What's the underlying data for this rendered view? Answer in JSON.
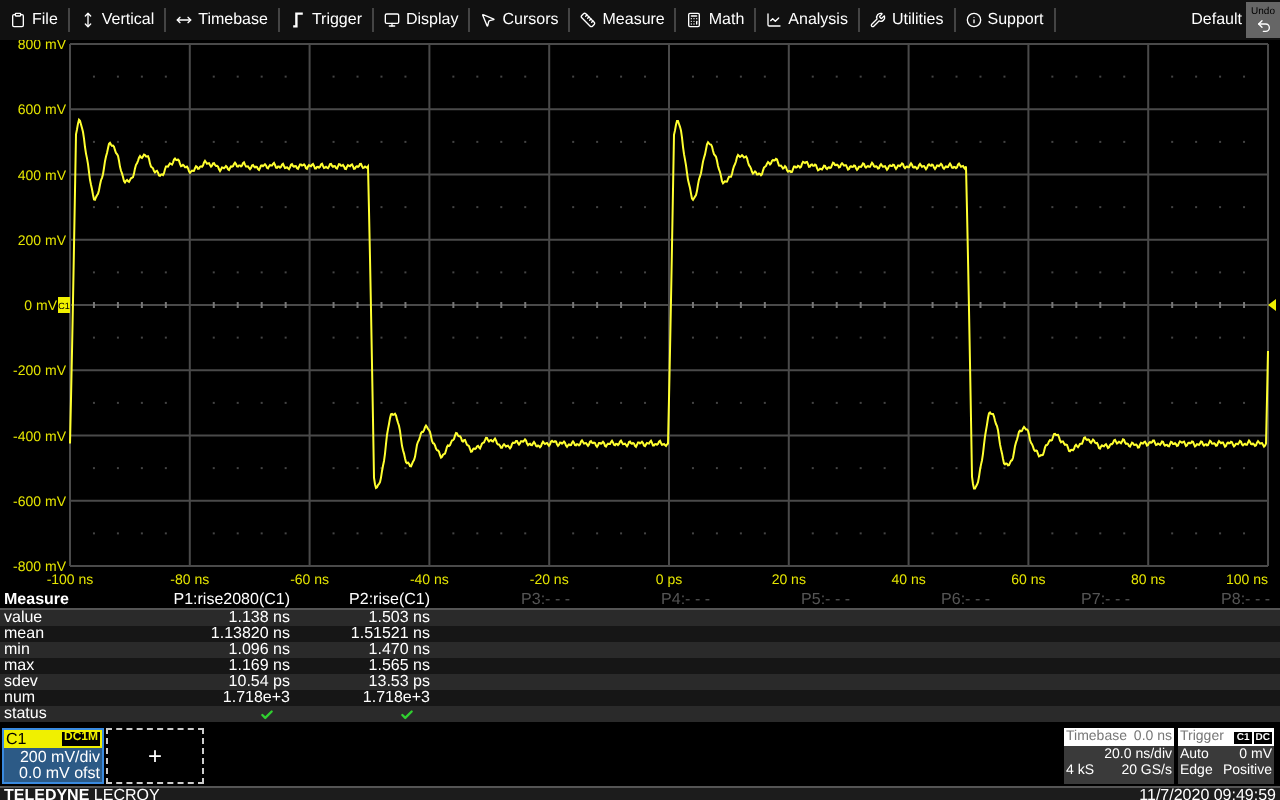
{
  "menu": [
    {
      "label": "File"
    },
    {
      "label": "Vertical"
    },
    {
      "label": "Timebase"
    },
    {
      "label": "Trigger"
    },
    {
      "label": "Display"
    },
    {
      "label": "Cursors"
    },
    {
      "label": "Measure"
    },
    {
      "label": "Math"
    },
    {
      "label": "Analysis"
    },
    {
      "label": "Utilities"
    },
    {
      "label": "Support"
    }
  ],
  "default_label": "Default",
  "undo_button": "Undo",
  "plot": {
    "y_labels": [
      "800 mV",
      "600 mV",
      "400 mV",
      "200 mV",
      "0 mV",
      "-200 mV",
      "-400 mV",
      "-600 mV",
      "-800 mV"
    ],
    "x_labels": [
      "-100 ns",
      "-80 ns",
      "-60 ns",
      "-40 ns",
      "-20 ns",
      "0 ps",
      "20 ns",
      "40 ns",
      "60 ns",
      "80 ns",
      "100 ns"
    ],
    "trace_marker": "C1"
  },
  "measure": {
    "title": "Measure",
    "row_labels": [
      "value",
      "mean",
      "min",
      "max",
      "sdev",
      "num",
      "status"
    ],
    "columns": [
      {
        "header": "P1:rise2080(C1)",
        "active": true,
        "values": [
          "1.138 ns",
          "1.13820 ns",
          "1.096 ns",
          "1.169 ns",
          "10.54 ps",
          "1.718e+3"
        ],
        "status_ok": true
      },
      {
        "header": "P2:rise(C1)",
        "active": true,
        "values": [
          "1.503 ns",
          "1.51521 ns",
          "1.470 ns",
          "1.565 ns",
          "13.53 ps",
          "1.718e+3"
        ],
        "status_ok": true
      },
      {
        "header": "P3:- - -",
        "active": false
      },
      {
        "header": "P4:- - -",
        "active": false
      },
      {
        "header": "P5:- - -",
        "active": false
      },
      {
        "header": "P6:- - -",
        "active": false
      },
      {
        "header": "P7:- - -",
        "active": false
      },
      {
        "header": "P8:- - -",
        "active": false
      }
    ]
  },
  "channel": {
    "name": "C1",
    "coupling": "DC1M",
    "scale": "200 mV/div",
    "offset": "0.0 mV ofst"
  },
  "add_button": "+",
  "timebase": {
    "title": "Timebase",
    "delay": "0.0 ns",
    "scale": "20.0 ns/div",
    "samples": "4 kS",
    "rate": "20 GS/s"
  },
  "trigger": {
    "title": "Trigger",
    "source": "C1",
    "coupling": "DC",
    "mode": "Auto",
    "level": "0 mV",
    "type": "Edge",
    "slope": "Positive"
  },
  "footer": {
    "brand_bold": "TELEDYNE",
    "brand": "LECROY",
    "datetime": "11/7/2020 09:49:59"
  }
}
